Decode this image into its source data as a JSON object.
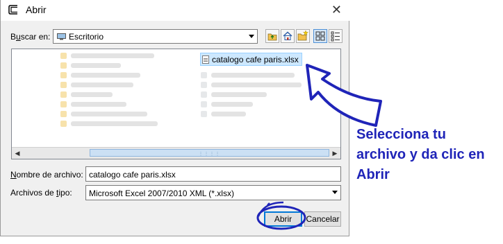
{
  "window": {
    "title": "Abrir",
    "close_glyph": "✕"
  },
  "lookin": {
    "label_prefix": "B",
    "label_accel": "u",
    "label_suffix": "scar en:",
    "value": "Escritorio",
    "icon": "desktop-icon"
  },
  "toolbar": {
    "icons": [
      "up-folder-icon",
      "home-icon",
      "new-folder-icon",
      "thumbnails-view-icon",
      "details-view-icon"
    ]
  },
  "file_list": {
    "selected_file": "catalogo cafe paris.xlsx",
    "selected_icon": "spreadsheet-file-icon"
  },
  "filename": {
    "label_accel": "N",
    "label_rest": "ombre de archivo:",
    "value": "catalogo cafe paris.xlsx"
  },
  "filetype": {
    "label_prefix": "Archivos de ",
    "label_accel": "t",
    "label_suffix": "ipo:",
    "value": "Microsoft Excel 2007/2010 XML (*.xlsx)"
  },
  "buttons": {
    "open": "Abrir",
    "cancel": "Cancelar"
  },
  "annotation": {
    "text": "Selecciona tu archivo y da clic en Abrir",
    "color": "#1f24b8"
  }
}
